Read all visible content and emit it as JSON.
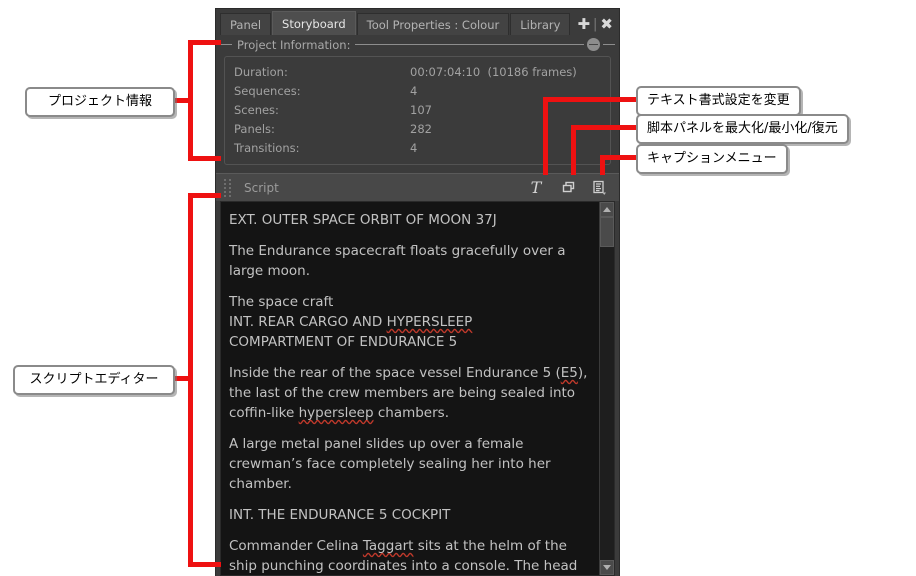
{
  "window": {
    "tabs": [
      {
        "label": "Panel",
        "active": false
      },
      {
        "label": "Storyboard",
        "active": true
      },
      {
        "label": "Tool Properties : Colour",
        "active": false
      },
      {
        "label": "Library",
        "active": false
      }
    ],
    "add_tab_icon": "plus-icon",
    "close_tab_icon": "close-icon",
    "accent_color": "#ee1111",
    "panel_bg": "#3b3b3b",
    "editor_bg": "#141414"
  },
  "project_information": {
    "section_label": "Project Information:",
    "collapse_icon": "collapse-circle-icon",
    "rows": [
      {
        "label": "Duration:",
        "value": "00:07:04:10",
        "extra": "(10186 frames)"
      },
      {
        "label": "Sequences:",
        "value": "4",
        "extra": ""
      },
      {
        "label": "Scenes:",
        "value": "107",
        "extra": ""
      },
      {
        "label": "Panels:",
        "value": "282",
        "extra": ""
      },
      {
        "label": "Transitions:",
        "value": "4",
        "extra": ""
      }
    ]
  },
  "script_panel": {
    "title": "Script",
    "grip_icon": "drag-grip-icon",
    "tools": [
      {
        "name": "text-format-icon",
        "glyph": "T"
      },
      {
        "name": "maximize-restore-icon",
        "glyph": ""
      },
      {
        "name": "caption-menu-icon",
        "glyph": ""
      }
    ],
    "scrollbar": {
      "up_icon": "scroll-up-arrow-icon",
      "down_icon": "scroll-down-arrow-icon"
    },
    "content": {
      "p1": "EXT. OUTER SPACE ORBIT OF MOON 37J",
      "p2": "The Endurance spacecraft floats gracefully over a large moon.",
      "p3_l1": "The space craft",
      "p3_l2a": "INT. REAR CARGO AND ",
      "p3_l2b": "HYPERSLEEP",
      "p3_l3": "COMPARTMENT OF ENDURANCE 5",
      "p4_a": "Inside the rear of the space vessel Endurance 5 (",
      "p4_b": "E5",
      "p4_c": "), the last of the crew members are being sealed into coffin-like ",
      "p4_d": "hypersleep",
      "p4_e": " chambers.",
      "p5": "A large metal panel slides up over a female crewman’s face completely sealing her into her chamber.",
      "p6": "INT. THE ENDURANCE 5 COCKPIT",
      "p7_a": "Commander Celina ",
      "p7_b": "Taggart",
      "p7_c": " sits at the helm of the ship punching coordinates into a console. The head"
    }
  },
  "annotations": [
    {
      "id": "project-information",
      "text": "プロジェクト情報"
    },
    {
      "id": "script-editor",
      "text": "スクリプトエディター"
    },
    {
      "id": "change-text-format",
      "text": "テキスト書式設定を変更"
    },
    {
      "id": "maximize-script-panel",
      "text": "脚本パネルを最大化/最小化/復元"
    },
    {
      "id": "caption-menu",
      "text": "キャプションメニュー"
    }
  ]
}
